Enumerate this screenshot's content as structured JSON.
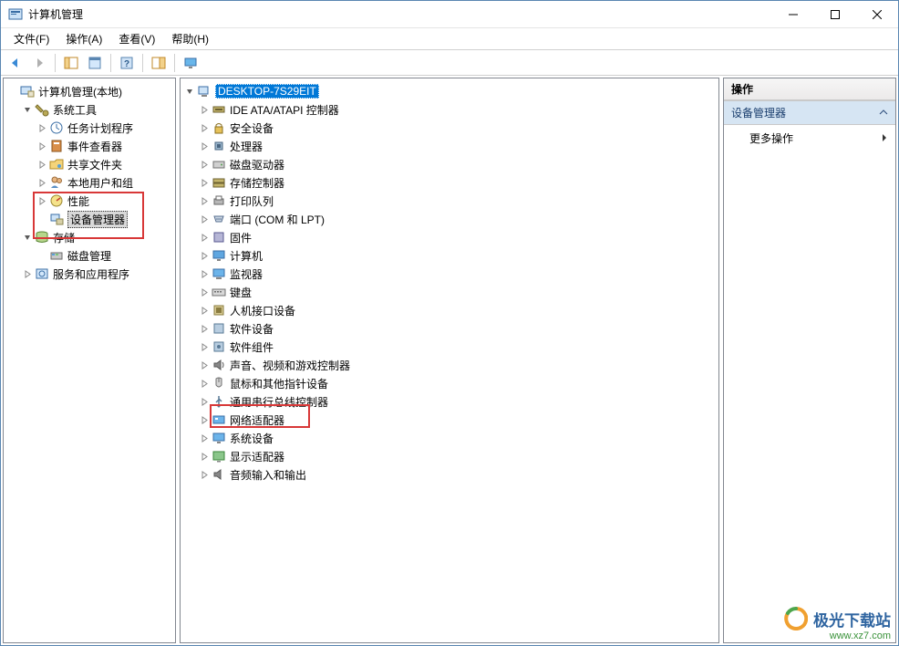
{
  "window": {
    "title": "计算机管理"
  },
  "menu": {
    "file": "文件(F)",
    "action": "操作(A)",
    "view": "查看(V)",
    "help": "帮助(H)"
  },
  "left_tree": {
    "root": "计算机管理(本地)",
    "system_tools": "系统工具",
    "task_scheduler": "任务计划程序",
    "event_viewer": "事件查看器",
    "shared_folders": "共享文件夹",
    "local_users": "本地用户和组",
    "performance": "性能",
    "device_manager": "设备管理器",
    "storage": "存储",
    "disk_management": "磁盘管理",
    "services_apps": "服务和应用程序"
  },
  "mid_tree": {
    "root": "DESKTOP-7S29EIT",
    "ide": "IDE ATA/ATAPI 控制器",
    "security": "安全设备",
    "processor": "处理器",
    "disk_drives": "磁盘驱动器",
    "storage_ctrl": "存储控制器",
    "print_queue": "打印队列",
    "ports": "端口 (COM 和 LPT)",
    "firmware": "固件",
    "computer": "计算机",
    "monitor": "监视器",
    "keyboard": "键盘",
    "hid": "人机接口设备",
    "soft_dev": "软件设备",
    "soft_comp": "软件组件",
    "sound": "声音、视频和游戏控制器",
    "mouse": "鼠标和其他指针设备",
    "usb": "通用串行总线控制器",
    "network": "网络适配器",
    "system_dev": "系统设备",
    "display": "显示适配器",
    "audio_io": "音频输入和输出"
  },
  "right": {
    "header": "操作",
    "section": "设备管理器",
    "more": "更多操作"
  },
  "watermark": {
    "text": "极光下载站",
    "url": "www.xz7.com"
  }
}
